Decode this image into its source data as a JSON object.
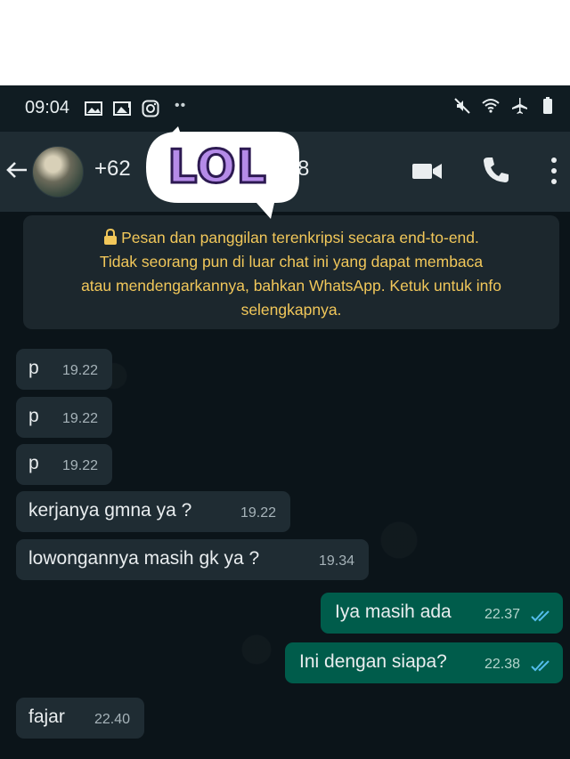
{
  "status_bar": {
    "time": "09:04",
    "left_icons": [
      "gallery-icon",
      "screenshot-icon",
      "instagram-icon"
    ],
    "right_icons": [
      "mute-icon",
      "wifi-icon",
      "airplane-icon",
      "battery-icon"
    ]
  },
  "header": {
    "contact_start": "+62",
    "contact_end": "8",
    "actions": [
      "video-call-icon",
      "voice-call-icon",
      "more-options-icon"
    ]
  },
  "sticker": {
    "text": "LOL"
  },
  "notice": {
    "lines": [
      "Pesan dan panggilan terenkripsi secara end-to-end.",
      "Tidak seorang pun di luar chat ini yang dapat membaca",
      "atau mendengarkannya, bahkan WhatsApp. Ketuk untuk info",
      "selengkapnya."
    ]
  },
  "messages": [
    {
      "direction": "in",
      "text": "p",
      "time": "19.22"
    },
    {
      "direction": "in",
      "text": "p",
      "time": "19.22"
    },
    {
      "direction": "in",
      "text": "p",
      "time": "19.22"
    },
    {
      "direction": "in",
      "text": "kerjanya gmna ya ?",
      "time": "19.22"
    },
    {
      "direction": "in",
      "text": "lowongannya masih gk ya ?",
      "time": "19.34"
    },
    {
      "direction": "out",
      "text": "Iya masih ada",
      "time": "22.37",
      "status": "read"
    },
    {
      "direction": "out",
      "text": "Ini dengan siapa?",
      "time": "22.38",
      "status": "read"
    },
    {
      "direction": "in",
      "text": "fajar",
      "time": "22.40"
    }
  ],
  "colors": {
    "chat_background": "#0b1419",
    "incoming_bubble": "#1f2c33",
    "outgoing_bubble": "#005c4b",
    "notice_text": "#f1c75a",
    "read_ticks": "#53bdeb"
  }
}
